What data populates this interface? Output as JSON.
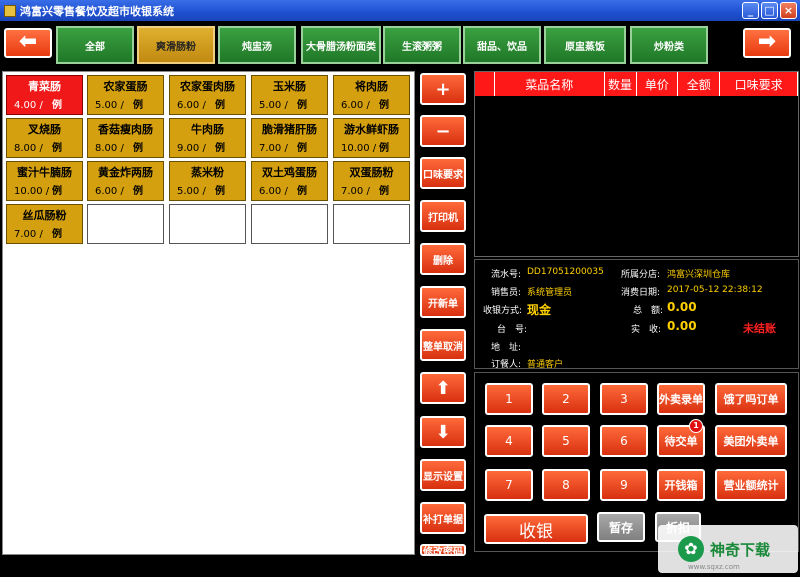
{
  "window": {
    "title": "鸿富兴零售餐饮及超市收银系统",
    "min": "_",
    "max": "□",
    "close": "×"
  },
  "nav": {
    "prev": "⬅",
    "next": "➡"
  },
  "categories": [
    "全部",
    "爽滑肠粉",
    "炖盅汤",
    "大骨腊汤粉面类",
    "生滚粥粥",
    "甜品、饮品",
    "原盅蒸饭",
    "炒粉类"
  ],
  "active_category": "爽滑肠粉",
  "dishes": [
    {
      "name": "青菜肠",
      "price": "4.00 /",
      "unit": "例"
    },
    {
      "name": "农家蛋肠",
      "price": "5.00 /",
      "unit": "例"
    },
    {
      "name": "农家蛋肉肠",
      "price": "6.00 /",
      "unit": "例"
    },
    {
      "name": "玉米肠",
      "price": "5.00 /",
      "unit": "例"
    },
    {
      "name": "将肉肠",
      "price": "6.00 /",
      "unit": "例"
    },
    {
      "name": "叉烧肠",
      "price": "8.00 /",
      "unit": "例"
    },
    {
      "name": "香菇瘦肉肠",
      "price": "8.00 /",
      "unit": "例"
    },
    {
      "name": "牛肉肠",
      "price": "9.00 /",
      "unit": "例"
    },
    {
      "name": "脆滑猪肝肠",
      "price": "7.00 /",
      "unit": "例"
    },
    {
      "name": "游水鲜虾肠",
      "price": "10.00 /",
      "unit": "例"
    },
    {
      "name": "蜜汁牛腩肠",
      "price": "10.00 /",
      "unit": "例"
    },
    {
      "name": "黄金炸两肠",
      "price": "6.00 /",
      "unit": "例"
    },
    {
      "name": "蒸米粉",
      "price": "5.00 /",
      "unit": "例"
    },
    {
      "name": "双土鸡蛋肠",
      "price": "6.00 /",
      "unit": "例"
    },
    {
      "name": "双蛋肠粉",
      "price": "7.00 /",
      "unit": "例"
    },
    {
      "name": "丝瓜肠粉",
      "price": "7.00 /",
      "unit": "例"
    }
  ],
  "side_buttons": [
    "+",
    "−",
    "口味要求",
    "打印机",
    "删除",
    "开新单",
    "整单取消",
    "⬆",
    "⬇",
    "显示设置",
    "补打单据",
    "修改密码"
  ],
  "order_table": {
    "columns": [
      "",
      "菜品名称",
      "数量",
      "单价",
      "全额",
      "口味要求"
    ]
  },
  "info": {
    "serial_label": "流水号:",
    "serial": "DD17051200035",
    "branch_label": "所属分店:",
    "branch": "鸿富兴深圳仓库",
    "cashier_label": "销售员:",
    "cashier": "系统管理员",
    "date_label": "消费日期:",
    "date": "2017-05-12 22:38:12",
    "paymethod_label": "收银方式:",
    "paymethod": "现金",
    "total_label": "总　额:",
    "total": "0.00",
    "table_label": "台　号:",
    "received_label": "实　收:",
    "received": "0.00",
    "status": "未结账",
    "address_label": "地　址:",
    "customer_label": "订餐人:",
    "customer": "普通客户"
  },
  "keypad": {
    "numbers": [
      "1",
      "2",
      "3",
      "4",
      "5",
      "6",
      "7",
      "8",
      "9"
    ],
    "col3": [
      "外卖录单",
      "待交单",
      "开钱箱"
    ],
    "col4": [
      "饿了吗订单",
      "美团外卖单",
      "营业额统计"
    ],
    "badge": "1",
    "checkout": "收银",
    "hold": "暂存",
    "extra": "折扣"
  },
  "watermark": {
    "text": "神奇下载",
    "url": "www.sqxz.com"
  },
  "colors": {
    "accent": "#ff5020",
    "selected": "#f01818",
    "dish": "#d4a010",
    "category": "#2a8a30"
  }
}
